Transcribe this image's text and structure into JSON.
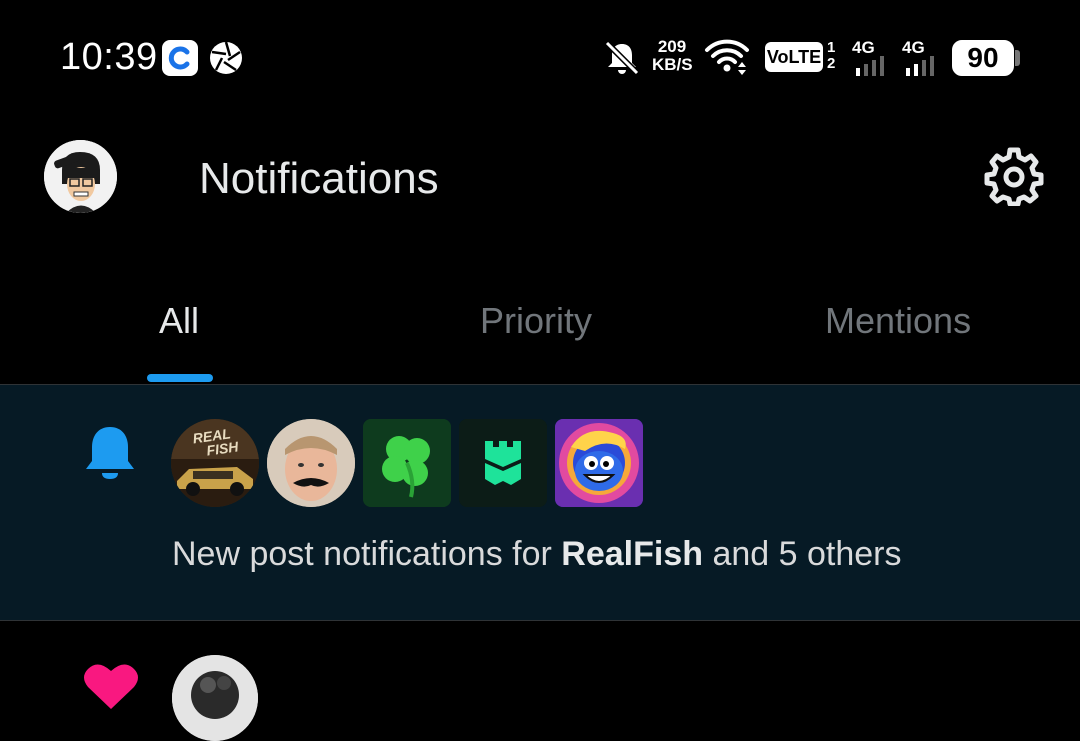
{
  "status_bar": {
    "time": "10:39",
    "net_speed_value": "209",
    "net_speed_unit": "KB/S",
    "volte": "VoLTE",
    "sim_1": "1",
    "sim_2": "2",
    "signal_1_label": "4G",
    "signal_2_label": "4G",
    "battery": "90",
    "icons": [
      "g-app-icon",
      "shutter-icon",
      "bell-off-icon",
      "wifi-icon",
      "signal-icon",
      "battery-icon"
    ]
  },
  "header": {
    "title": "Notifications",
    "settings_icon": "gear-icon"
  },
  "tabs": [
    {
      "label": "All",
      "active": true
    },
    {
      "label": "Priority",
      "active": false
    },
    {
      "label": "Mentions",
      "active": false
    }
  ],
  "notification": {
    "icon": "bell-icon",
    "text_prefix": "New post notifications for ",
    "account": "RealFish",
    "text_suffix": " and 5 others",
    "avatar_labels": [
      "REAL",
      "FISH"
    ],
    "avatars": [
      "realfish-avatar",
      "man-mustache-avatar",
      "clover-avatar",
      "castle-avatar",
      "blue-creature-avatar"
    ]
  },
  "next_notification": {
    "icon": "heart-icon"
  },
  "colors": {
    "accent": "#1d9bf0",
    "background": "#000000",
    "highlight_row": "#061a25",
    "heart": "#f91880",
    "muted_text": "#71767b"
  }
}
